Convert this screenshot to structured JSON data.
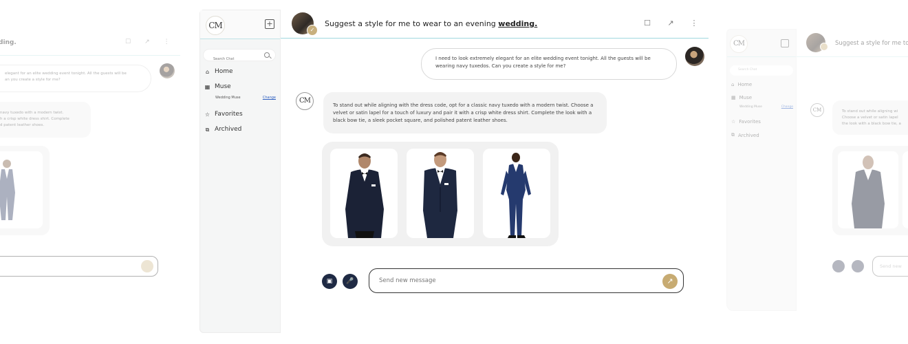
{
  "app": {
    "logo": "CM",
    "search_placeholder": "Search Chat",
    "nav": {
      "home": "Home",
      "muse": "Muse",
      "muse_sub": "Wedding Muse",
      "change": "Change",
      "favorites": "Favorites",
      "archived": "Archived"
    }
  },
  "header": {
    "title_prefix": "Suggest a style for me to wear to an evening ",
    "title_emphasis": "wedding."
  },
  "conversation": {
    "user_message": "I need to look extremely elegant for an elite wedding event tonight. All the guests will be wearing navy tuxedos. Can you create a style for me?",
    "bot_message": "To stand out while aligning with the dress code, opt for a classic navy tuxedo with a modern twist. Choose a velvet or satin lapel for a touch of luxury and pair it with a crisp white dress shirt. Complete the look with a black bow tie, a sleek pocket square, and polished patent leather shoes."
  },
  "composer": {
    "placeholder": "Send new message"
  },
  "ghost_left": {
    "title": "ding.",
    "user_message": "elegant for an elite wedding event tonight. All the guests will be\nan you create a style for me?",
    "bot_message": "navy tuxedo with a modern twist.\nh a crisp white dress shirt. Complete\nd patent leather shoes."
  },
  "ghost_right": {
    "logo": "CM",
    "search_placeholder": "Search Chat",
    "home": "Home",
    "muse": "Muse",
    "muse_sub": "Wedding Muse",
    "change": "Change",
    "favorites": "Favorites",
    "archived": "Archived",
    "title": "Suggest a style for me to",
    "bot_message": "To stand out while aligning wi\nChoose a velvet or satin lapel\nthe look with a black bow tie, a",
    "composer_placeholder": "Send new"
  },
  "colors": {
    "accent_gold": "#c7ab72",
    "navy": "#1f2a44",
    "divider_teal": "#9fd8de"
  }
}
